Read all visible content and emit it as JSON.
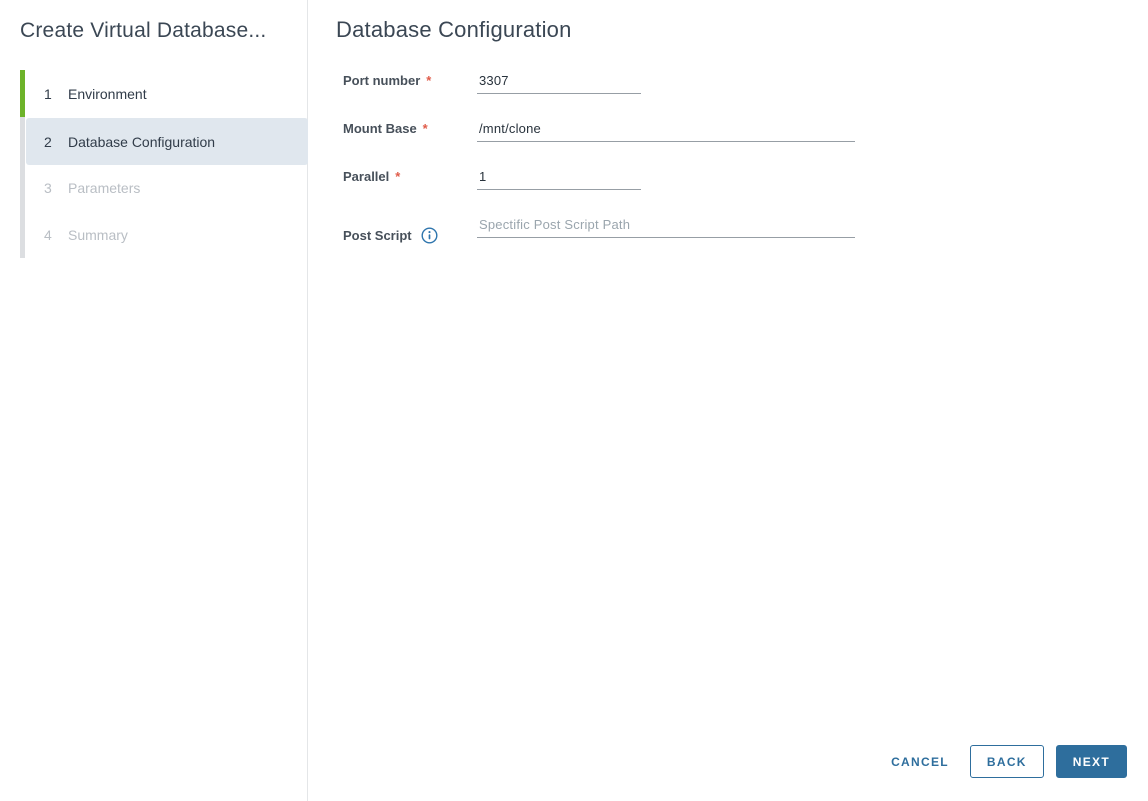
{
  "colors": {
    "accent_blue": "#2e6e9d",
    "step_green": "#6db32a",
    "active_step_bg": "#e0e7ee",
    "required_red": "#e05b49",
    "heading_text": "#3b4754",
    "disabled_step_text": "#b9bec4"
  },
  "sidebar": {
    "title": "Create Virtual Database...",
    "steps": [
      {
        "number": "1",
        "label": "Environment",
        "state": "completed"
      },
      {
        "number": "2",
        "label": "Database Configuration",
        "state": "active"
      },
      {
        "number": "3",
        "label": "Parameters",
        "state": "disabled"
      },
      {
        "number": "4",
        "label": "Summary",
        "state": "disabled"
      }
    ]
  },
  "main": {
    "heading": "Database Configuration",
    "required_marker": "*",
    "fields": [
      {
        "label": "Port number",
        "required": true,
        "value": "3307",
        "placeholder": ""
      },
      {
        "label": "Mount Base",
        "required": true,
        "value": "/mnt/clone",
        "placeholder": ""
      },
      {
        "label": "Parallel",
        "required": true,
        "value": "1",
        "placeholder": ""
      },
      {
        "label": "Post Script",
        "required": false,
        "value": "",
        "placeholder": "Spectific Post Script Path",
        "info_icon": "info-circle-icon"
      }
    ]
  },
  "footer": {
    "cancel_label": "CANCEL",
    "back_label": "BACK",
    "next_label": "NEXT"
  }
}
